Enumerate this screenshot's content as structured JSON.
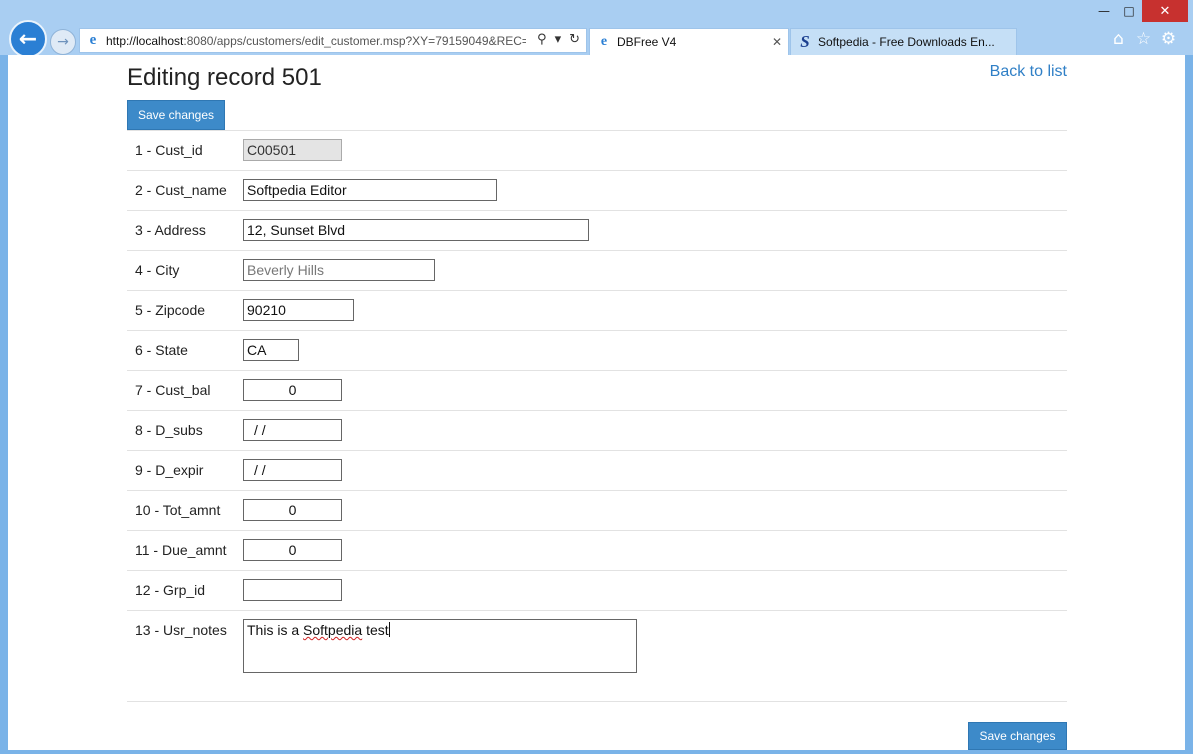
{
  "browser": {
    "address_host": "http://localhost",
    "address_rest": ":8080/apps/customers/edit_customer.msp?XY=79159049&REC=",
    "tabs": [
      {
        "label": "DBFree V4"
      },
      {
        "label": "Softpedia - Free Downloads En..."
      }
    ]
  },
  "page": {
    "title": "Editing record 501",
    "back_link": "Back to list",
    "save_label": "Save changes"
  },
  "fields": [
    {
      "label": "1 - Cust_id",
      "value": "C00501"
    },
    {
      "label": "2 - Cust_name",
      "value": "Softpedia Editor"
    },
    {
      "label": "3 - Address",
      "value": "12, Sunset Blvd"
    },
    {
      "label": "4 - City",
      "value": "Beverly Hills"
    },
    {
      "label": "5 - Zipcode",
      "value": "90210"
    },
    {
      "label": "6 - State",
      "value": "CA"
    },
    {
      "label": "7 - Cust_bal",
      "value": "0"
    },
    {
      "label": "8 - D_subs",
      "value": "/  /"
    },
    {
      "label": "9 - D_expir",
      "value": "/  /"
    },
    {
      "label": "10 - Tot_amnt",
      "value": "0"
    },
    {
      "label": "11 - Due_amnt",
      "value": "0"
    },
    {
      "label": "12 - Grp_id",
      "value": ""
    },
    {
      "label": "13 - Usr_notes",
      "value_prefix": "This is a ",
      "value_word": "Softpedia",
      "value_suffix": " test"
    }
  ],
  "icons": {
    "back": "back-arrow-icon",
    "forward": "forward-arrow-icon",
    "home": "home-icon",
    "favorites": "star-icon",
    "settings": "gear-icon"
  },
  "colors": {
    "chrome": "#a9cef2",
    "accent_button": "#3d8ac9",
    "link": "#2f7fc6",
    "close": "#c7312f"
  }
}
